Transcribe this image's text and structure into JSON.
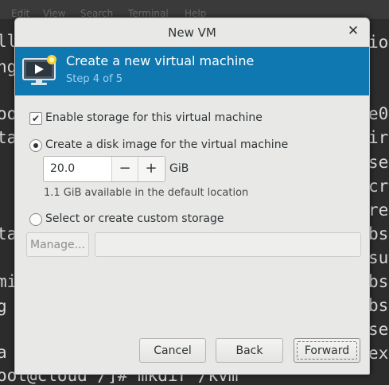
{
  "terminal": {
    "menu": [
      "Edit",
      "View",
      "Search",
      "Terminal",
      "Help"
    ],
    "left_fragments": [
      "ll",
      "ng",
      "",
      "oo",
      "ta",
      "",
      "",
      "",
      "ta",
      "",
      "mi",
      "g",
      "",
      "a"
    ],
    "right_fragments": [
      "io",
      "",
      "",
      "e0",
      "ir",
      "se",
      "cr",
      "re",
      "bs",
      "su",
      "bs",
      "bs",
      "se",
      "ex"
    ],
    "bottom_line": "oot@cloud /]# mkdir /kvm"
  },
  "dialog": {
    "title": "New VM",
    "close_glyph": "✕",
    "banner": {
      "title": "Create a new virtual machine",
      "step": "Step 4 of 5",
      "color": "#0f78b0"
    },
    "enable_storage": {
      "label": "Enable storage for this virtual machine",
      "checked": true
    },
    "disk_image_option": {
      "label": "Create a disk image for the virtual machine",
      "selected": true,
      "size_value": "20.0",
      "decrement": "−",
      "increment": "+",
      "unit": "GiB",
      "available_hint": "1.1 GiB available in the default location"
    },
    "custom_storage_option": {
      "label": "Select or create custom storage",
      "selected": false,
      "manage_label": "Manage...",
      "path_value": ""
    },
    "buttons": {
      "cancel": "Cancel",
      "back": "Back",
      "forward": "Forward"
    }
  }
}
